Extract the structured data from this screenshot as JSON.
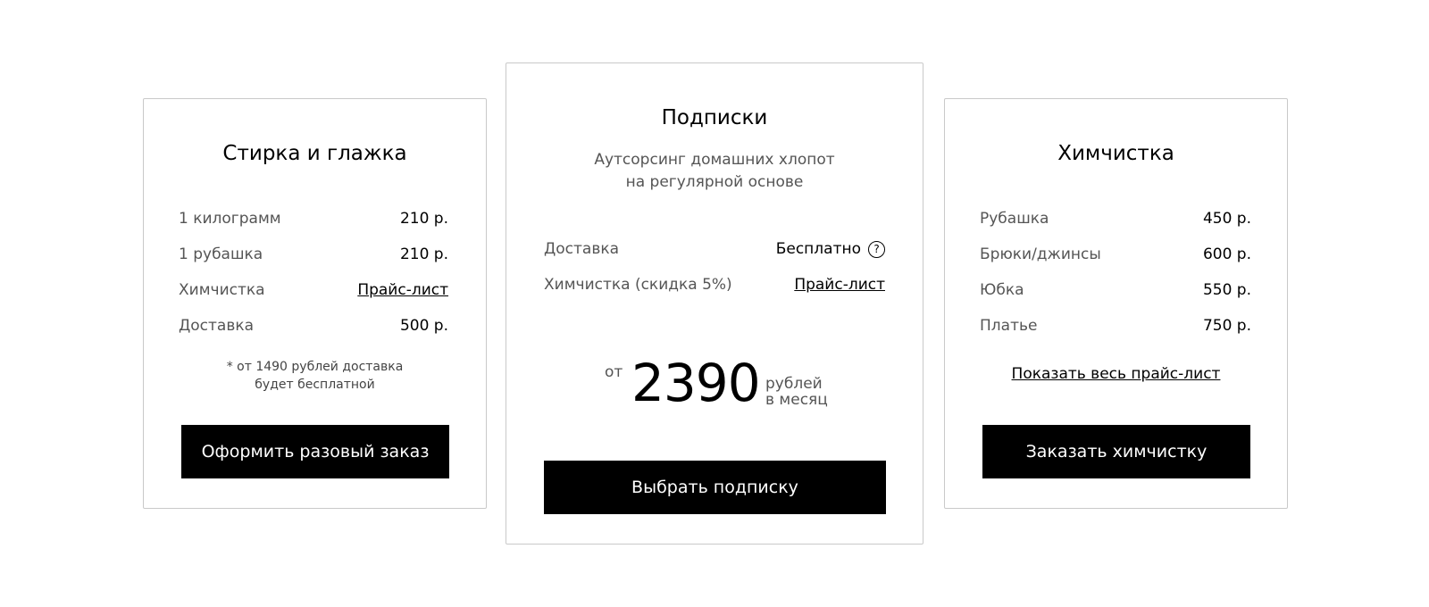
{
  "left_card": {
    "title": "Стирка и глажка",
    "rows": [
      {
        "label": "1 килограмм",
        "value": "210 р."
      },
      {
        "label": "1 рубашка",
        "value": "210 р."
      },
      {
        "label": "Химчистка",
        "value": "Прайс-лист"
      },
      {
        "label": "Доставка",
        "value": "500 р."
      }
    ],
    "note_line1": "* от 1490 рублей доставка",
    "note_line2": "будет бесплатной",
    "button": "Оформить разовый заказ"
  },
  "center_card": {
    "title": "Подписки",
    "subtitle_line1": "Аутсорсинг домашних хлопот",
    "subtitle_line2": "на регулярной основе",
    "rows": [
      {
        "label": "Доставка",
        "value": "Бесплатно",
        "help_icon": "?"
      },
      {
        "label": "Химчистка (скидка 5%)",
        "value": "Прайс-лист"
      }
    ],
    "price_from": "от",
    "price_amount": "2390",
    "price_unit_line1": "рублей",
    "price_unit_line2": "в месяц",
    "button": "Выбрать подписку"
  },
  "right_card": {
    "title": "Химчистка",
    "rows": [
      {
        "label": "Рубашка",
        "value": "450 р."
      },
      {
        "label": "Брюки/джинсы",
        "value": "600 р."
      },
      {
        "label": "Юбка",
        "value": "550 р."
      },
      {
        "label": "Платье",
        "value": "750 р."
      }
    ],
    "full_pricelist_link": "Показать весь прайс-лист",
    "button": "Заказать химчистку"
  }
}
